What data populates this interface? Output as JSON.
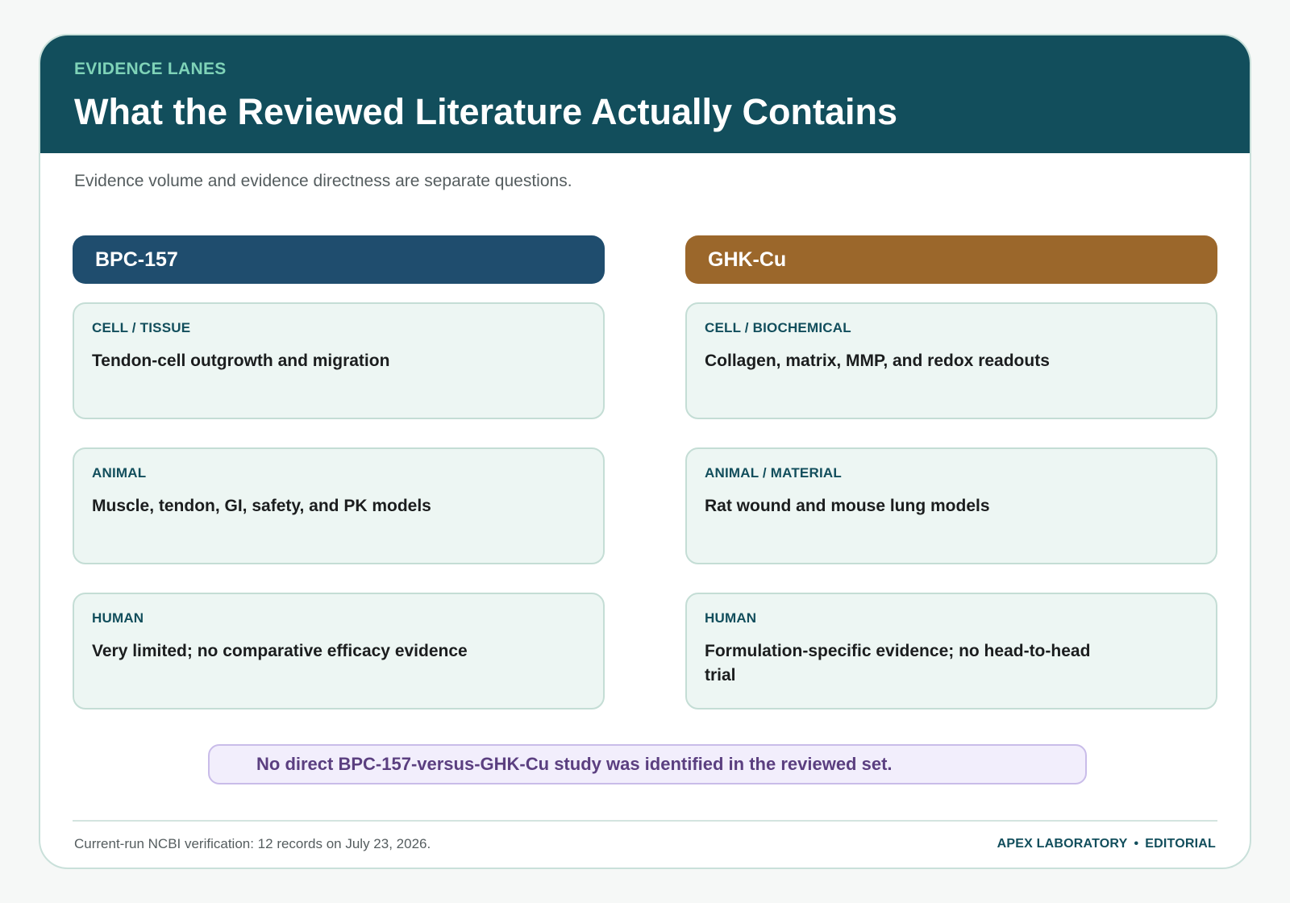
{
  "header": {
    "eyebrow": "EVIDENCE LANES",
    "title": "What the Reviewed Literature Actually Contains",
    "subtitle": "Evidence volume and evidence directness are separate questions."
  },
  "lanes": [
    {
      "name": "BPC-157",
      "color": "#1f4d6e",
      "tiles": [
        {
          "label": "CELL / TISSUE",
          "text": "Tendon-cell outgrowth and migration"
        },
        {
          "label": "ANIMAL",
          "text": "Muscle, tendon, GI, safety, and PK models"
        },
        {
          "label": "HUMAN",
          "text": "Very limited; no comparative efficacy evidence"
        }
      ]
    },
    {
      "name": "GHK-Cu",
      "color": "#9b672b",
      "tiles": [
        {
          "label": "CELL / BIOCHEMICAL",
          "text": "Collagen, matrix, MMP, and redox readouts"
        },
        {
          "label": "ANIMAL / MATERIAL",
          "text": "Rat wound and mouse lung models"
        },
        {
          "label": "HUMAN",
          "text": "Formulation-specific evidence; no head-to-head trial"
        }
      ]
    }
  ],
  "callout": "No direct BPC-157-versus-GHK-Cu study was identified in the reviewed set.",
  "footer": {
    "note": "Current-run NCBI verification: 12 records on July 23, 2026.",
    "org": "APEX LABORATORY",
    "separator": "•",
    "section": "EDITORIAL"
  },
  "colors": {
    "banner": "#124e5c",
    "eyebrow": "#7fd3b8",
    "tile_background": "#edf6f3",
    "callout_background": "#f2eefc",
    "callout_text": "#5b3f80"
  }
}
